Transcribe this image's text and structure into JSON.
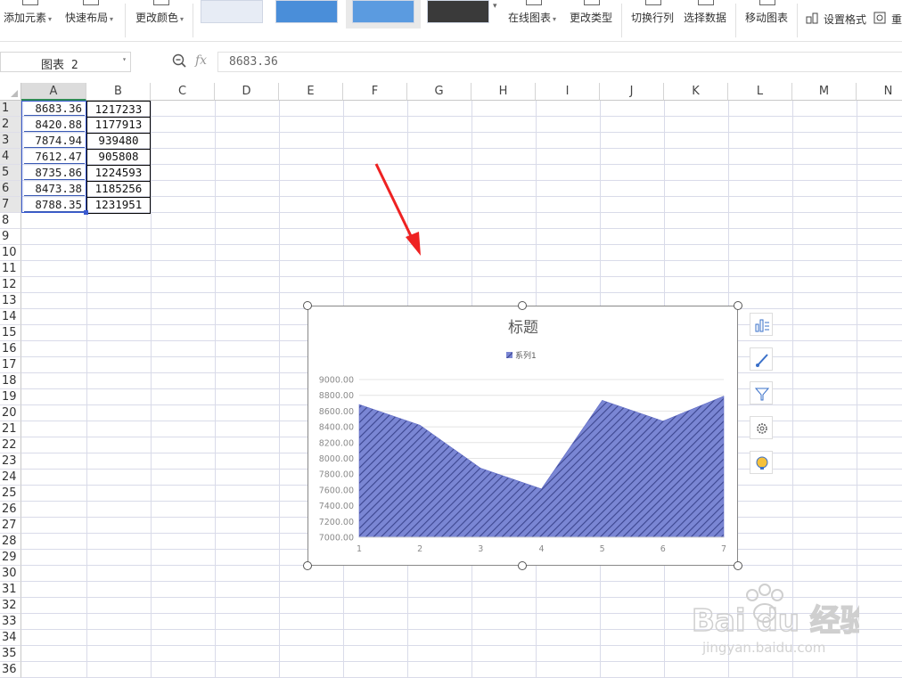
{
  "ribbon": {
    "add_element": "添加元素",
    "quick_layout": "快速布局",
    "change_color": "更改颜色",
    "online_chart": "在线图表",
    "change_type": "更改类型",
    "switch_row_col": "切换行列",
    "select_data": "选择数据",
    "move_chart": "移动图表",
    "set_format": "设置格式",
    "reset": "重"
  },
  "formula_bar": {
    "name_box": "图表 2",
    "fx_label": "fx",
    "value": "8683.36"
  },
  "columns": [
    "A",
    "B",
    "C",
    "D",
    "E",
    "F",
    "G",
    "H",
    "I",
    "J",
    "K",
    "L",
    "M",
    "N"
  ],
  "rows": [
    "1",
    "2",
    "3",
    "4",
    "5",
    "6",
    "7",
    "8",
    "9",
    "10",
    "11",
    "12",
    "13",
    "14",
    "15",
    "16",
    "17",
    "18",
    "19",
    "20",
    "21",
    "22",
    "23",
    "24",
    "25",
    "26",
    "27",
    "28",
    "29",
    "30",
    "31",
    "32",
    "33",
    "34",
    "35",
    "36"
  ],
  "cells": {
    "A": [
      "8683.36",
      "8420.88",
      "7874.94",
      "7612.47",
      "8735.86",
      "8473.38",
      "8788.35"
    ],
    "B": [
      "1217233",
      "1177913",
      "939480",
      "905808",
      "1224593",
      "1185256",
      "1231951"
    ]
  },
  "chart_data": {
    "type": "area",
    "title": "标题",
    "x": [
      1,
      2,
      3,
      4,
      5,
      6,
      7
    ],
    "series": [
      {
        "name": "系列1",
        "values": [
          8683.36,
          8420.88,
          7874.94,
          7612.47,
          8735.86,
          8473.38,
          8788.35
        ]
      }
    ],
    "ylim": [
      7000,
      9000
    ],
    "yticks": [
      "9000.00",
      "8800.00",
      "8600.00",
      "8400.00",
      "8200.00",
      "8000.00",
      "7800.00",
      "7600.00",
      "7400.00",
      "7200.00",
      "7000.00"
    ],
    "xticks": [
      "1",
      "2",
      "3",
      "4",
      "5",
      "6",
      "7"
    ],
    "legend": "top",
    "grid": true,
    "fill_color": "#7a86d4",
    "hatch_color": "#3c468f"
  },
  "watermark": {
    "brand": "Bai du 经验",
    "url": "jingyan.baidu.com"
  },
  "colors": {
    "arrow": "#ee2222",
    "selection": "#2e8b57",
    "gridline": "#d9dbe9"
  }
}
